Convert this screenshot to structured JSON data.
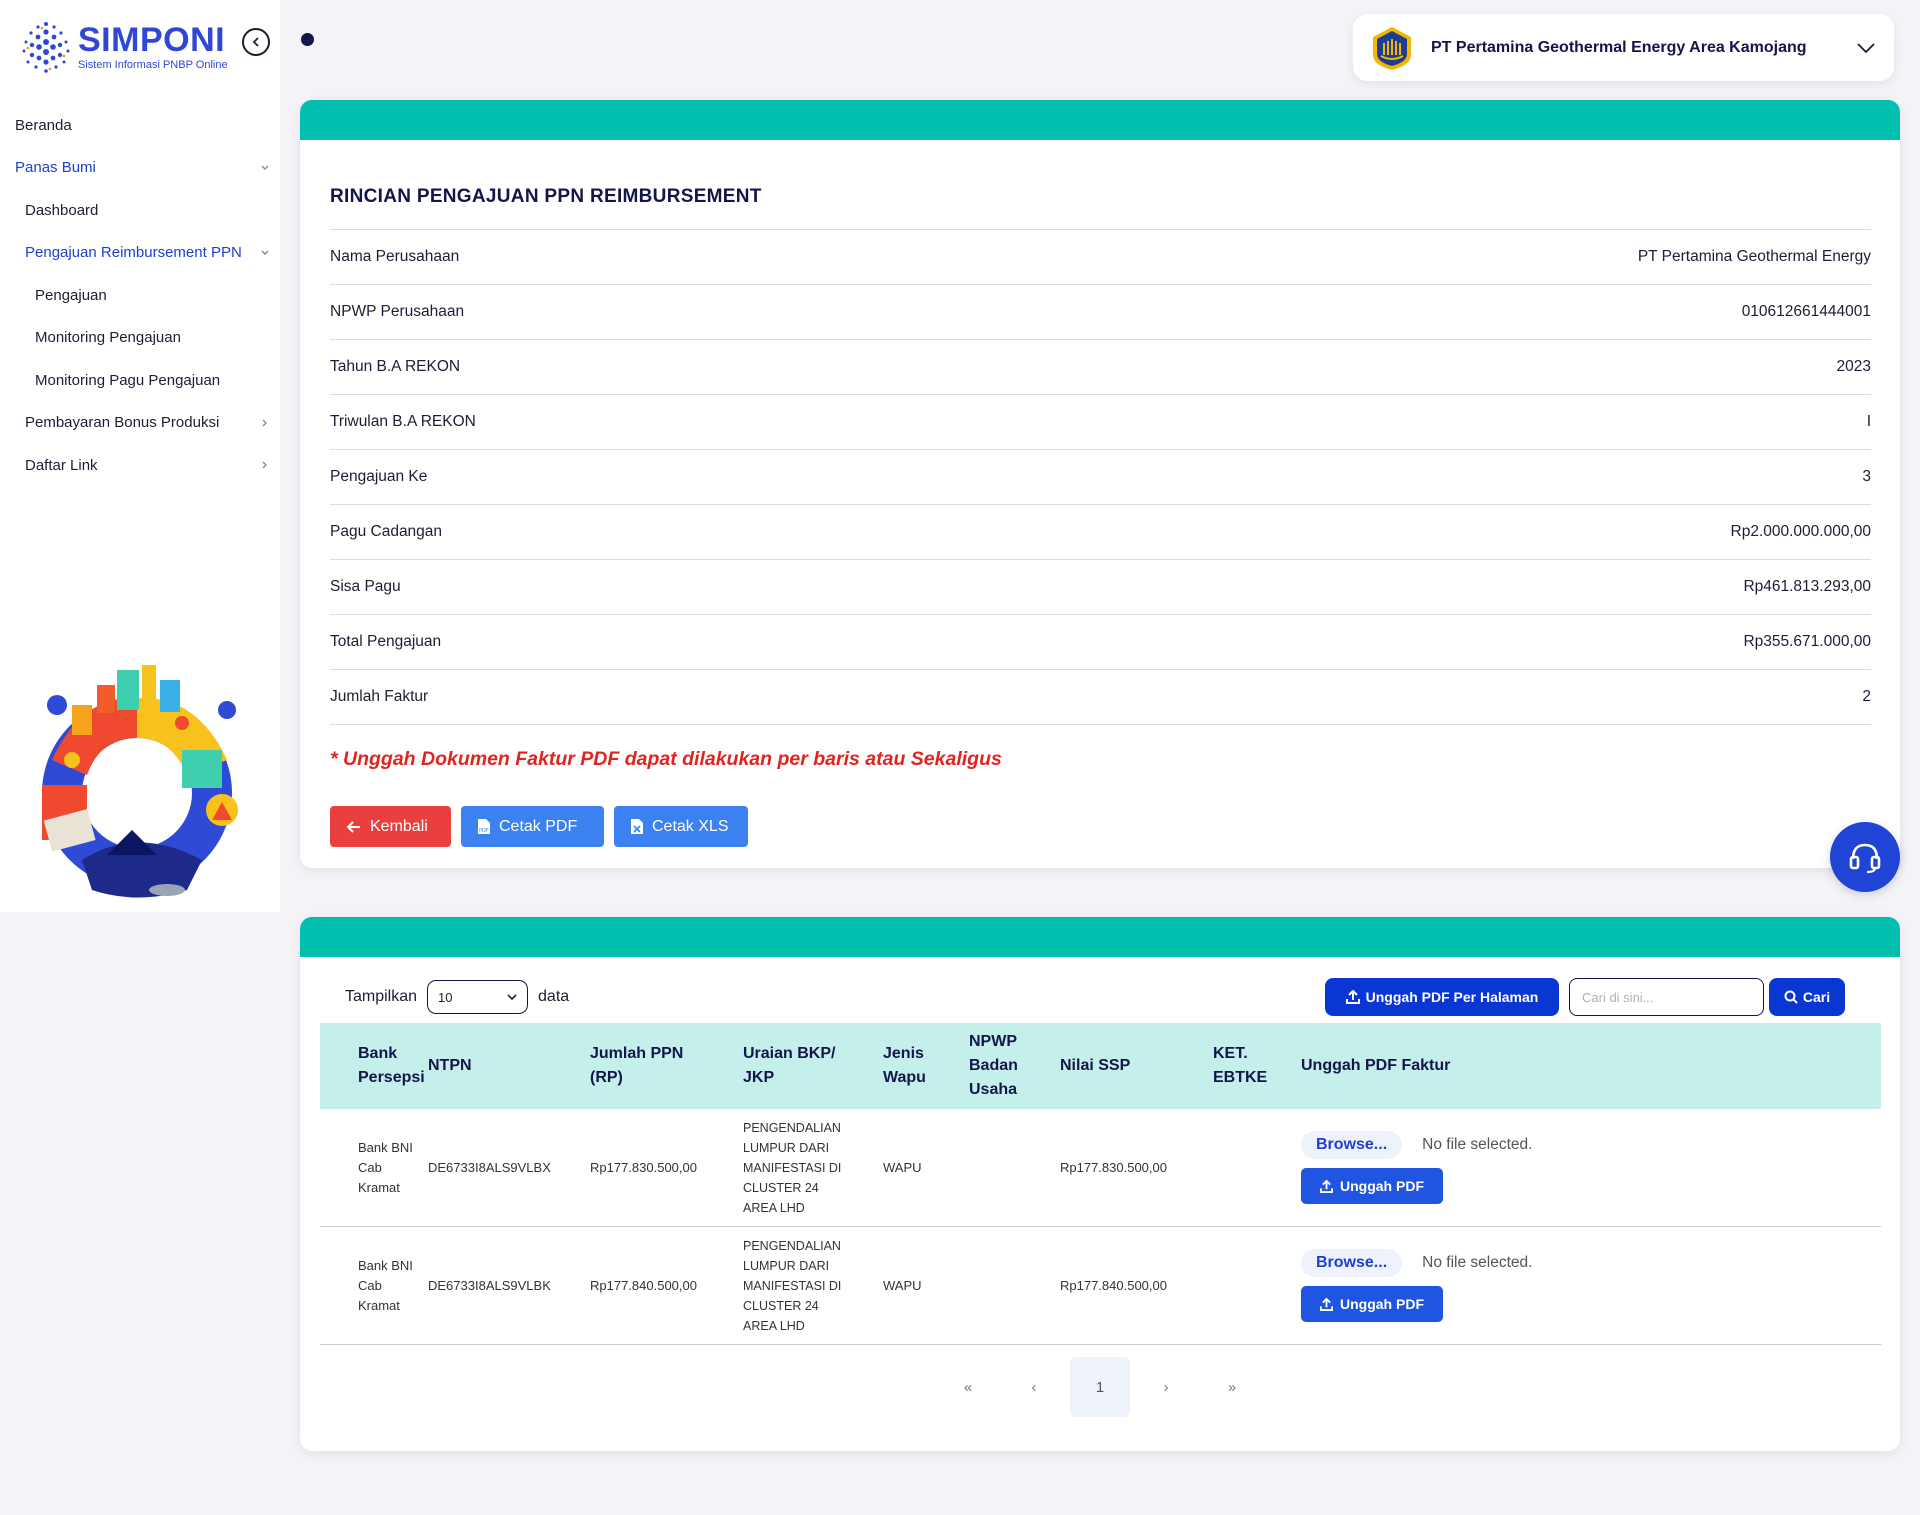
{
  "app": {
    "logo_title": "SIMPONI",
    "logo_subtitle": "Sistem Informasi PNBP Online",
    "company": "PT Pertamina Geothermal Energy Area Kamojang"
  },
  "sidebar": {
    "items": [
      {
        "label": "Beranda",
        "level": 0,
        "active": false,
        "chevron": ""
      },
      {
        "label": "Panas Bumi",
        "level": 0,
        "active": true,
        "chevron": "down"
      },
      {
        "label": "Dashboard",
        "level": 1,
        "active": false,
        "chevron": ""
      },
      {
        "label": "Pengajuan Reimbursement PPN",
        "level": 1,
        "active": true,
        "chevron": "down"
      },
      {
        "label": "Pengajuan",
        "level": 2,
        "active": false,
        "chevron": ""
      },
      {
        "label": "Monitoring Pengajuan",
        "level": 2,
        "active": false,
        "chevron": ""
      },
      {
        "label": "Monitoring Pagu Pengajuan",
        "level": 2,
        "active": false,
        "chevron": ""
      },
      {
        "label": "Pembayaran Bonus Produksi",
        "level": 1,
        "active": false,
        "chevron": "right"
      },
      {
        "label": "Daftar Link",
        "level": 1,
        "active": false,
        "chevron": "right"
      }
    ]
  },
  "detail": {
    "title": "RINCIAN PENGAJUAN PPN REIMBURSEMENT",
    "rows": [
      {
        "key": "Nama Perusahaan",
        "value": "PT Pertamina Geothermal Energy"
      },
      {
        "key": "NPWP Perusahaan",
        "value": "010612661444001"
      },
      {
        "key": "Tahun B.A REKON",
        "value": "2023"
      },
      {
        "key": "Triwulan B.A REKON",
        "value": "I"
      },
      {
        "key": "Pengajuan Ke",
        "value": "3"
      },
      {
        "key": "Pagu Cadangan",
        "value": "Rp2.000.000.000,00"
      },
      {
        "key": "Sisa Pagu",
        "value": "Rp461.813.293,00"
      },
      {
        "key": "Total Pengajuan",
        "value": "Rp355.671.000,00"
      },
      {
        "key": "Jumlah Faktur",
        "value": "2"
      }
    ],
    "note": "* Unggah Dokumen Faktur PDF dapat dilakukan per baris atau Sekaligus",
    "buttons": {
      "back": "Kembali",
      "print_pdf": "Cetak PDF",
      "print_xls": "Cetak XLS"
    }
  },
  "table": {
    "show_label": "Tampilkan",
    "page_size": "10",
    "data_label": "data",
    "upload_page_label": "Unggah PDF Per Halaman",
    "search_placeholder": "Cari di sini...",
    "search_label": "Cari",
    "headers": [
      [
        "Bank",
        "Persepsi"
      ],
      [
        "NTPN"
      ],
      [
        "Jumlah PPN",
        "(RP)"
      ],
      [
        "Uraian BKP/",
        "JKP"
      ],
      [
        "Jenis",
        "Wapu"
      ],
      [
        "NPWP",
        "Badan",
        "Usaha"
      ],
      [
        "Nilai SSP"
      ],
      [
        "KET.",
        "EBTKE"
      ],
      [
        "Unggah PDF Faktur"
      ]
    ],
    "rows": [
      {
        "bank": [
          "Bank BNI",
          "Cab",
          "Kramat"
        ],
        "ntpn": "DE6733I8ALS9VLBX",
        "jumlah_ppn": "Rp177.830.500,00",
        "uraian": [
          "PENGENDALIAN",
          "LUMPUR DARI",
          "MANIFESTASI DI",
          "CLUSTER 24",
          "AREA LHD"
        ],
        "jenis_wapu": "WAPU",
        "npwp_badan": "",
        "nilai_ssp": "Rp177.830.500,00",
        "ket": "",
        "browse_label": "Browse...",
        "file_status": "No file selected.",
        "upload_label": "Unggah PDF"
      },
      {
        "bank": [
          "Bank BNI",
          "Cab",
          "Kramat"
        ],
        "ntpn": "DE6733I8ALS9VLBK",
        "jumlah_ppn": "Rp177.840.500,00",
        "uraian": [
          "PENGENDALIAN",
          "LUMPUR DARI",
          "MANIFESTASI DI",
          "CLUSTER 24",
          "AREA LHD"
        ],
        "jenis_wapu": "WAPU",
        "npwp_badan": "",
        "nilai_ssp": "Rp177.840.500,00",
        "ket": "",
        "browse_label": "Browse...",
        "file_status": "No file selected.",
        "upload_label": "Unggah PDF"
      }
    ],
    "pagination": {
      "first": "«",
      "prev": "‹",
      "current": "1",
      "next": "›",
      "last": "»"
    }
  },
  "colors": {
    "accent": "#00bfae",
    "primary": "#0a36d4",
    "danger": "#ea3f3f",
    "button_blue": "#3b82f0",
    "note": "#e0251f"
  }
}
